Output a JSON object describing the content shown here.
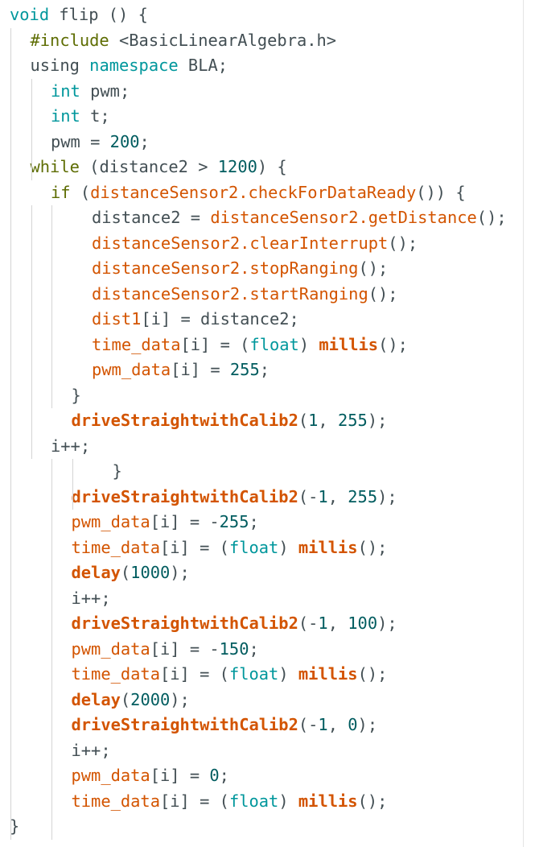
{
  "editor": {
    "lines": [
      {
        "indent": 0,
        "tokens": [
          {
            "t": "void",
            "c": "ty"
          },
          {
            "t": " flip () {",
            "c": "default"
          }
        ]
      },
      {
        "indent": 1,
        "tokens": [
          {
            "t": "#include",
            "c": "pp"
          },
          {
            "t": " <BasicLinearAlgebra.h>",
            "c": "default"
          }
        ]
      },
      {
        "indent": 1,
        "tokens": [
          {
            "t": "using",
            "c": "default"
          },
          {
            "t": " namespace",
            "c": "ty"
          },
          {
            "t": " BLA;",
            "c": "default"
          }
        ]
      },
      {
        "indent": 2,
        "tokens": [
          {
            "t": "int",
            "c": "ty"
          },
          {
            "t": " pwm;",
            "c": "default"
          }
        ]
      },
      {
        "indent": 2,
        "tokens": [
          {
            "t": "int",
            "c": "ty"
          },
          {
            "t": " t;",
            "c": "default"
          }
        ]
      },
      {
        "indent": 2,
        "tokens": [
          {
            "t": "pwm = ",
            "c": "default"
          },
          {
            "t": "200",
            "c": "num"
          },
          {
            "t": ";",
            "c": "default"
          }
        ]
      },
      {
        "indent": 1,
        "tokens": [
          {
            "t": "while",
            "c": "kw"
          },
          {
            "t": " (distance2 > ",
            "c": "default"
          },
          {
            "t": "1200",
            "c": "num"
          },
          {
            "t": ") {",
            "c": "default"
          }
        ]
      },
      {
        "indent": 2,
        "tokens": [
          {
            "t": "if",
            "c": "kw"
          },
          {
            "t": " (",
            "c": "default"
          },
          {
            "t": "distanceSensor2.checkForDataReady",
            "c": "fn"
          },
          {
            "t": "()) {",
            "c": "default"
          }
        ]
      },
      {
        "indent": 4,
        "tokens": [
          {
            "t": "distance2 = ",
            "c": "default"
          },
          {
            "t": "distanceSensor2.getDistance",
            "c": "fn"
          },
          {
            "t": "();",
            "c": "default"
          }
        ]
      },
      {
        "indent": 4,
        "tokens": [
          {
            "t": "distanceSensor2.clearInterrupt",
            "c": "fn"
          },
          {
            "t": "();",
            "c": "default"
          }
        ]
      },
      {
        "indent": 4,
        "tokens": [
          {
            "t": "distanceSensor2.stopRanging",
            "c": "fn"
          },
          {
            "t": "();",
            "c": "default"
          }
        ]
      },
      {
        "indent": 4,
        "tokens": [
          {
            "t": "distanceSensor2.startRanging",
            "c": "fn"
          },
          {
            "t": "();",
            "c": "default"
          }
        ]
      },
      {
        "indent": 4,
        "tokens": [
          {
            "t": "dist1",
            "c": "fn"
          },
          {
            "t": "[i] = distance2;",
            "c": "default"
          }
        ]
      },
      {
        "indent": 4,
        "tokens": [
          {
            "t": "time_data",
            "c": "fn"
          },
          {
            "t": "[i] = (",
            "c": "default"
          },
          {
            "t": "float",
            "c": "ty"
          },
          {
            "t": ") ",
            "c": "default"
          },
          {
            "t": "millis",
            "c": "fnb"
          },
          {
            "t": "();",
            "c": "default"
          }
        ]
      },
      {
        "indent": 4,
        "tokens": [
          {
            "t": "pwm_data",
            "c": "fn"
          },
          {
            "t": "[i] = ",
            "c": "default"
          },
          {
            "t": "255",
            "c": "num"
          },
          {
            "t": ";",
            "c": "default"
          }
        ]
      },
      {
        "indent": 3,
        "tokens": [
          {
            "t": "}",
            "c": "default"
          }
        ]
      },
      {
        "indent": 3,
        "tokens": [
          {
            "t": "driveStraightwithCalib2",
            "c": "fnb"
          },
          {
            "t": "(",
            "c": "default"
          },
          {
            "t": "1",
            "c": "num"
          },
          {
            "t": ", ",
            "c": "default"
          },
          {
            "t": "255",
            "c": "num"
          },
          {
            "t": ");",
            "c": "default"
          }
        ]
      },
      {
        "indent": 2,
        "tokens": [
          {
            "t": "i++;",
            "c": "default"
          }
        ]
      },
      {
        "indent": 5,
        "tokens": [
          {
            "t": "}",
            "c": "default"
          }
        ]
      },
      {
        "indent": 3,
        "tokens": [
          {
            "t": "driveStraightwithCalib2",
            "c": "fnb"
          },
          {
            "t": "(-",
            "c": "default"
          },
          {
            "t": "1",
            "c": "num"
          },
          {
            "t": ", ",
            "c": "default"
          },
          {
            "t": "255",
            "c": "num"
          },
          {
            "t": ");",
            "c": "default"
          }
        ]
      },
      {
        "indent": 3,
        "tokens": [
          {
            "t": "pwm_data",
            "c": "fn"
          },
          {
            "t": "[i] = -",
            "c": "default"
          },
          {
            "t": "255",
            "c": "num"
          },
          {
            "t": ";",
            "c": "default"
          }
        ]
      },
      {
        "indent": 3,
        "tokens": [
          {
            "t": "time_data",
            "c": "fn"
          },
          {
            "t": "[i] = (",
            "c": "default"
          },
          {
            "t": "float",
            "c": "ty"
          },
          {
            "t": ") ",
            "c": "default"
          },
          {
            "t": "millis",
            "c": "fnb"
          },
          {
            "t": "();",
            "c": "default"
          }
        ]
      },
      {
        "indent": 3,
        "tokens": [
          {
            "t": "delay",
            "c": "fnb"
          },
          {
            "t": "(",
            "c": "default"
          },
          {
            "t": "1000",
            "c": "num"
          },
          {
            "t": ");",
            "c": "default"
          }
        ]
      },
      {
        "indent": 3,
        "tokens": [
          {
            "t": "i++;",
            "c": "default"
          }
        ]
      },
      {
        "indent": 3,
        "tokens": [
          {
            "t": "driveStraightwithCalib2",
            "c": "fnb"
          },
          {
            "t": "(-",
            "c": "default"
          },
          {
            "t": "1",
            "c": "num"
          },
          {
            "t": ", ",
            "c": "default"
          },
          {
            "t": "100",
            "c": "num"
          },
          {
            "t": ");",
            "c": "default"
          }
        ]
      },
      {
        "indent": 3,
        "tokens": [
          {
            "t": "pwm_data",
            "c": "fn"
          },
          {
            "t": "[i] = -",
            "c": "default"
          },
          {
            "t": "150",
            "c": "num"
          },
          {
            "t": ";",
            "c": "default"
          }
        ]
      },
      {
        "indent": 3,
        "tokens": [
          {
            "t": "time_data",
            "c": "fn"
          },
          {
            "t": "[i] = (",
            "c": "default"
          },
          {
            "t": "float",
            "c": "ty"
          },
          {
            "t": ") ",
            "c": "default"
          },
          {
            "t": "millis",
            "c": "fnb"
          },
          {
            "t": "();",
            "c": "default"
          }
        ]
      },
      {
        "indent": 3,
        "tokens": [
          {
            "t": "delay",
            "c": "fnb"
          },
          {
            "t": "(",
            "c": "default"
          },
          {
            "t": "2000",
            "c": "num"
          },
          {
            "t": ");",
            "c": "default"
          }
        ]
      },
      {
        "indent": 3,
        "tokens": [
          {
            "t": "driveStraightwithCalib2",
            "c": "fnb"
          },
          {
            "t": "(-",
            "c": "default"
          },
          {
            "t": "1",
            "c": "num"
          },
          {
            "t": ", ",
            "c": "default"
          },
          {
            "t": "0",
            "c": "num"
          },
          {
            "t": ");",
            "c": "default"
          }
        ]
      },
      {
        "indent": 3,
        "tokens": [
          {
            "t": "i++;",
            "c": "default"
          }
        ]
      },
      {
        "indent": 3,
        "tokens": [
          {
            "t": "pwm_data",
            "c": "fn"
          },
          {
            "t": "[i] = ",
            "c": "default"
          },
          {
            "t": "0",
            "c": "num"
          },
          {
            "t": ";",
            "c": "default"
          }
        ]
      },
      {
        "indent": 3,
        "tokens": [
          {
            "t": "time_data",
            "c": "fn"
          },
          {
            "t": "[i] = (",
            "c": "default"
          },
          {
            "t": "float",
            "c": "ty"
          },
          {
            "t": ") ",
            "c": "default"
          },
          {
            "t": "millis",
            "c": "fnb"
          },
          {
            "t": "();",
            "c": "default"
          }
        ]
      },
      {
        "indent": 0,
        "tokens": [
          {
            "t": "}",
            "c": "default"
          }
        ]
      }
    ],
    "guides": [
      {
        "level": 1,
        "from": 1,
        "to": 32
      },
      {
        "level": 2,
        "from": 3,
        "to": 6
      },
      {
        "level": 2,
        "from": 8,
        "to": 17
      },
      {
        "level": 3,
        "from": 8,
        "to": 15
      },
      {
        "level": 3,
        "from": 18,
        "to": 32
      },
      {
        "level": 4,
        "from": 18,
        "to": 19
      }
    ]
  }
}
